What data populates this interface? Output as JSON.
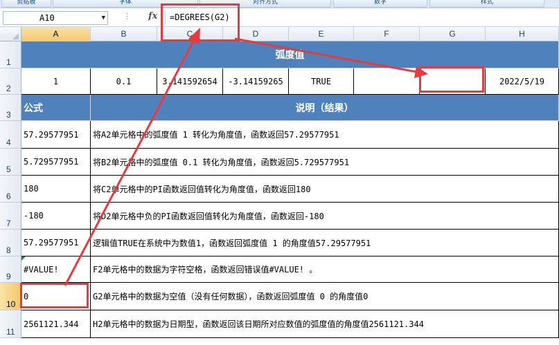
{
  "ribbon": {
    "groups": [
      "剪贴板",
      "字体",
      "对齐方式",
      "数字",
      "样式"
    ]
  },
  "formula_bar": {
    "name_box": "A10",
    "fx_label": "fx",
    "formula": "=DEGREES(G2)"
  },
  "columns": [
    "A",
    "B",
    "C",
    "D",
    "E",
    "F",
    "G",
    "H"
  ],
  "rows": [
    "1",
    "2",
    "3",
    "4",
    "5",
    "6",
    "7",
    "8",
    "9",
    "10",
    "11"
  ],
  "sheet": {
    "title": "弧度值",
    "row2": [
      "1",
      "0.1",
      "3.141592654",
      "-3.14159265",
      "TRUE",
      "",
      "",
      "2022/5/19"
    ],
    "header_formula": "公式",
    "header_desc": "说明（结果）",
    "results": [
      {
        "value": "57.29577951",
        "desc": "将A2单元格中的弧度值 1 转化为角度值，函数返回57.29577951"
      },
      {
        "value": "5.729577951",
        "desc": "将B2单元格中的弧度值 0.1 转化为角度值，函数返回5.729577951"
      },
      {
        "value": "180",
        "desc": "将C2单元格中的PI函数返回值转化为角度值，函数返回180"
      },
      {
        "value": "-180",
        "desc": "将D2单元格中负的PI函数返回值转化为角度值，函数返回-180"
      },
      {
        "value": "57.29577951",
        "desc": "逻辑值TRUE在系统中为数值1，函数返回弧度值 1 的角度值57.29577951"
      },
      {
        "value": "#VALUE!",
        "desc": "F2单元格中的数据为字符空格，函数返回错误值#VALUE! 。"
      },
      {
        "value": "0",
        "desc": "G2单元格中的数据为空值（没有任何数据），函数返回弧度值 0 的角度值0"
      },
      {
        "value": "2561121.344",
        "desc": "H2单元格中的数据为日期型，函数返回该日期所对应数值的弧度值的角度值2561121.344"
      }
    ]
  },
  "colors": {
    "header_fill": "#4f81bd",
    "highlight": "#e8393d",
    "selected_header": "#f5c86c"
  }
}
